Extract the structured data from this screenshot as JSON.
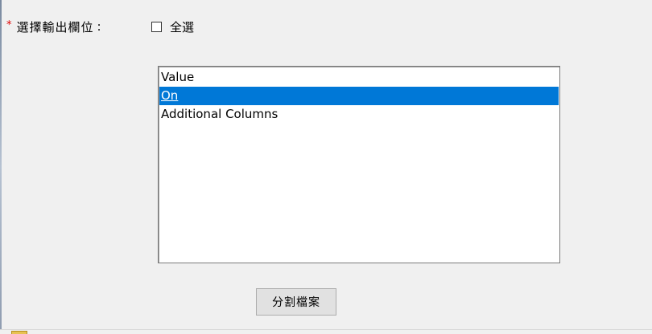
{
  "field": {
    "required_mark": "*",
    "label": "選擇輸出欄位",
    "colon": ":"
  },
  "select_all": {
    "label": "全選",
    "checked": false
  },
  "listbox": {
    "options": [
      {
        "label": "Value",
        "selected": false
      },
      {
        "label": "On",
        "selected": true
      },
      {
        "label": "Additional Columns",
        "selected": false
      }
    ]
  },
  "actions": {
    "split_label": "分割檔案"
  },
  "colors": {
    "selection": "#0078d7",
    "required": "#e00000",
    "background": "#f0f0f0"
  }
}
